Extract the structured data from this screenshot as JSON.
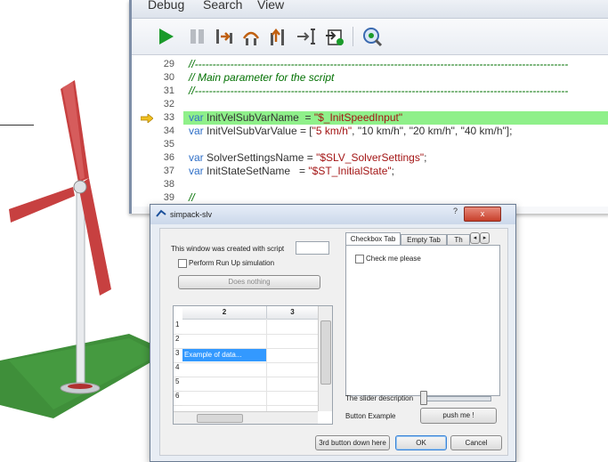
{
  "editor": {
    "menu": [
      "Debug",
      "Search",
      "View"
    ],
    "toolbar_icons": [
      "run-icon",
      "pause-icon",
      "step-into-icon",
      "step-over-icon",
      "step-out-icon",
      "run-to-cursor-icon",
      "breakpoint-icon",
      "inspect-icon"
    ],
    "lines": [
      {
        "num": "29",
        "code": "//---------------------------------------------------------------------------------------------------------",
        "kind": "comment"
      },
      {
        "num": "30",
        "code": "// Main parameter for the script",
        "kind": "comment"
      },
      {
        "num": "31",
        "code": "//---------------------------------------------------------------------------------------------------------",
        "kind": "comment"
      },
      {
        "num": "32",
        "code": "",
        "kind": "plain"
      },
      {
        "num": "33",
        "kw": "var",
        "code": " InitVelSubVarName  = ",
        "str": "\"$_InitSpeedInput\"",
        "rest": "",
        "kind": "highlight"
      },
      {
        "num": "34",
        "kw": "var",
        "code": " InitVelSubVarValue = [",
        "str": "\"5 km/h\"",
        "rest": ", \"10 km/h\", \"20 km/h\", \"40 km/h\"];",
        "kind": "code"
      },
      {
        "num": "35",
        "code": "",
        "kind": "plain"
      },
      {
        "num": "36",
        "kw": "var",
        "code": " SolverSettingsName = ",
        "str": "\"$SLV_SolverSettings\"",
        "rest": ";",
        "kind": "code"
      },
      {
        "num": "37",
        "kw": "var",
        "code": " InitStateSetName   = ",
        "str": "\"$ST_InitialState\"",
        "rest": ";",
        "kind": "code"
      },
      {
        "num": "38",
        "code": "",
        "kind": "plain"
      },
      {
        "num": "39",
        "code": "//",
        "kind": "comment"
      }
    ],
    "highlight_color": "#8ff08a"
  },
  "dialog": {
    "title": "simpack-slv",
    "created_label": "This window was created with script",
    "perform_label": "Perform Run Up simulation",
    "does_nothing": "Does nothing",
    "table": {
      "columns": [
        "2",
        "3"
      ],
      "rows": [
        "1",
        "2",
        "3",
        "4",
        "5",
        "6"
      ],
      "cell_text": "Example of data..."
    },
    "tabs": [
      "Checkbox Tab",
      "Empty Tab",
      "Th"
    ],
    "check_label": "Check me please",
    "slider_label": "The slider description",
    "button_example_label": "Button Example",
    "push_me": "push me !",
    "third_button": "3rd button down here",
    "ok": "OK",
    "cancel": "Cancel",
    "help_glyph": "?",
    "close_glyph": "x"
  }
}
